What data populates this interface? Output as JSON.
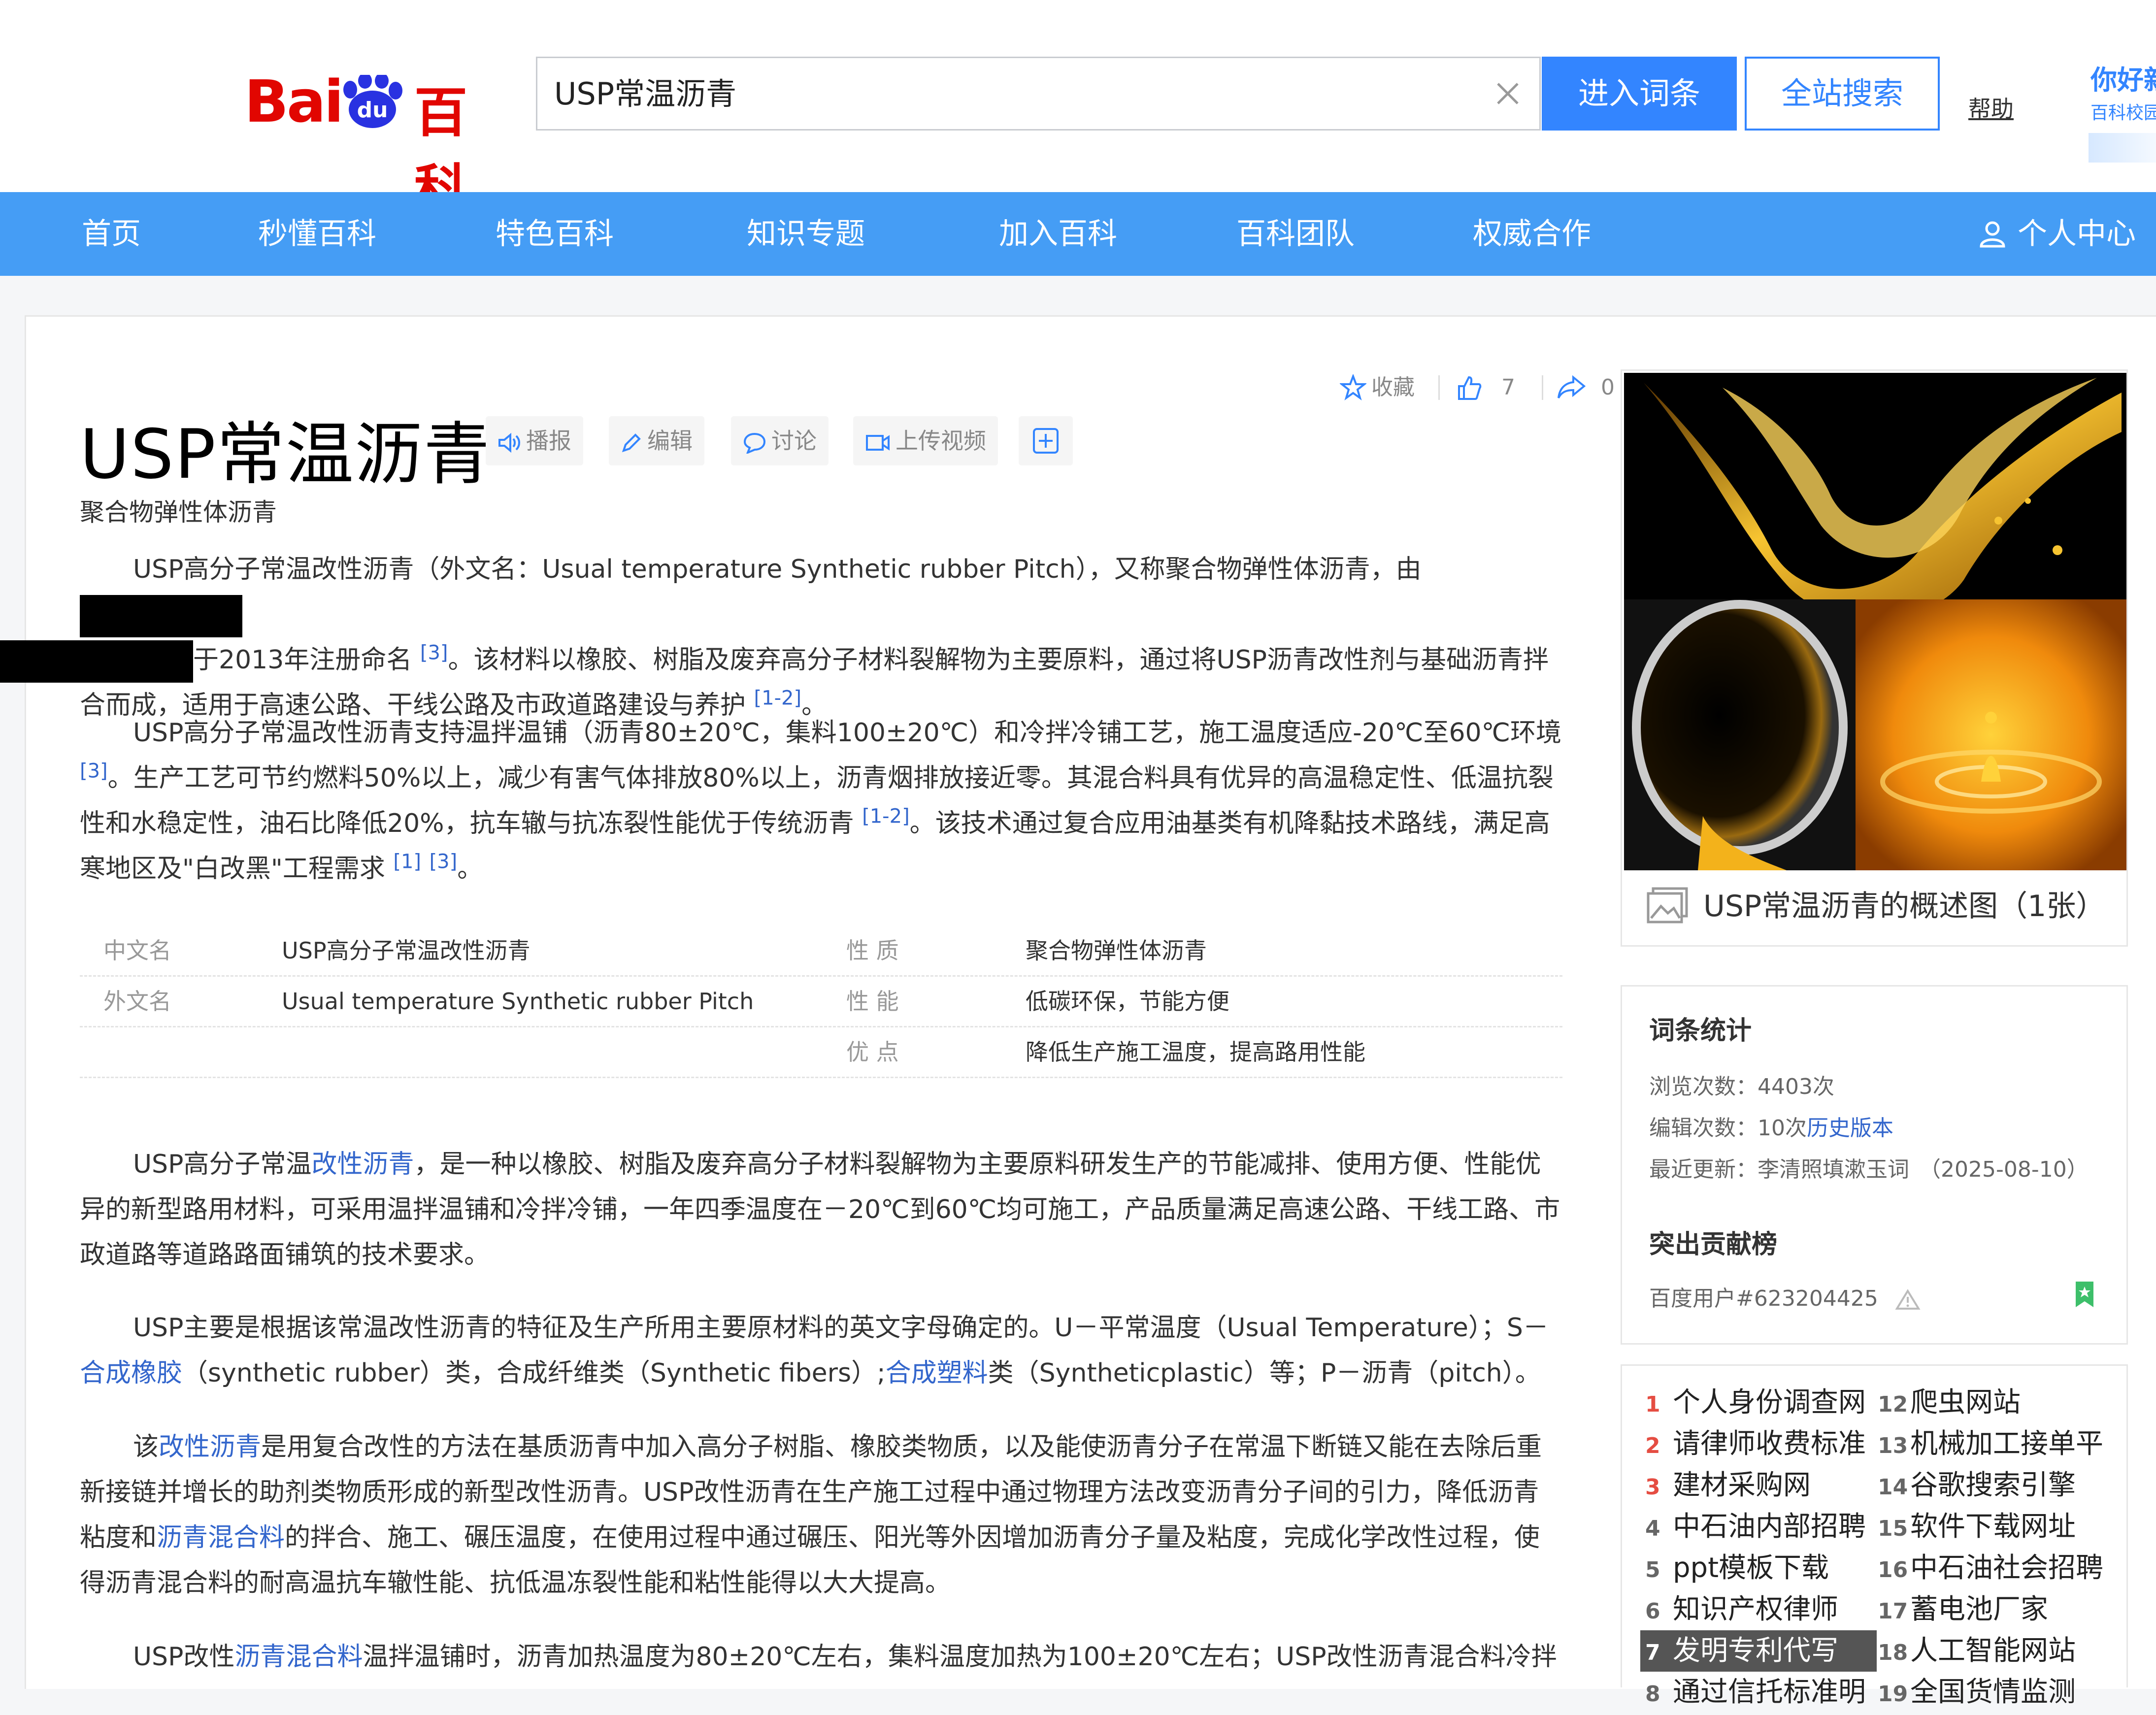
{
  "header": {
    "logo_bai": "Bai",
    "logo_du": "du",
    "logo_baike": "百科",
    "search_value": "USP常温沥青",
    "enter_button": "进入词条",
    "search_all_button": "全站搜索",
    "help_link": "帮助",
    "greeting": "你好新",
    "greeting_sub": "百科校园"
  },
  "nav": {
    "items": [
      "首页",
      "秒懂百科",
      "特色百科",
      "知识专题",
      "加入百科",
      "百科团队",
      "权威合作"
    ],
    "user_center": "个人中心"
  },
  "actions": {
    "favorite": "收藏",
    "likes": "7",
    "shares": "0"
  },
  "title": {
    "text": "USP常温沥青",
    "buttons": [
      "播报",
      "编辑",
      "讨论",
      "上传视频"
    ],
    "subtitle": "聚合物弹性体沥青"
  },
  "summary": {
    "p1": {
      "a": "USP高分子常温改性沥青（外文名：Usual temperature Synthetic rubber Pitch），又称聚合物弹性体沥青，由",
      "b": "于2013年注册命名",
      "ref1": "[3]",
      "c": "。该材料以橡胶、树脂及废弃高分子材料裂解物为主要原料，通过将USP沥青改性剂与基础沥青拌合而成，适用于高速公路、干线公路及市政道路建设与养护",
      "ref2": "[1-2]",
      "d": "。"
    },
    "p2": {
      "a": "USP高分子常温改性沥青支持温拌温铺（沥青80±20℃，集料100±20℃）和冷拌冷铺工艺，施工温度适应-20℃至60℃环境",
      "ref1": "[3]",
      "b": "。生产工艺可节约燃料50%以上，减少有害气体排放80%以上，沥青烟排放接近零。其混合料具有优异的高温稳定性、低温抗裂性和水稳定性，油石比降低20%，抗车辙与抗冻裂性能优于传统沥青",
      "ref2": "[1-2]",
      "c": "。该技术通过复合应用油基类有机降黏技术路线，满足高寒地区及\"白改黑\"工程需求",
      "ref3": "[1]",
      "ref4": "[3]",
      "d": "。"
    }
  },
  "basic_info": {
    "rows": [
      {
        "k1": "中文名",
        "v1": "USP高分子常温改性沥青",
        "k2": "性    质",
        "v2": "聚合物弹性体沥青"
      },
      {
        "k1": "外文名",
        "v1": "Usual temperature Synthetic rubber Pitch",
        "k2": "性    能",
        "v2": "低碳环保，节能方便"
      },
      {
        "k1": "",
        "v1": "",
        "k2": "优    点",
        "v2": "降低生产施工温度，提高路用性能"
      }
    ]
  },
  "body": {
    "p3": {
      "a": "USP高分子常温",
      "link1": "改性沥青",
      "b": "，是一种以橡胶、树脂及废弃高分子材料裂解物为主要原料研发生产的节能减排、使用方便、性能优异的新型路用材料，可采用温拌温铺和冷拌冷铺，一年四季温度在－20℃到60℃均可施工，产品质量满足高速公路、干线工路、市政道路等道路路面铺筑的技术要求。"
    },
    "p4": {
      "a": "USP主要是根据该常温改性沥青的特征及生产所用主要原材料的英文字母确定的。U－平常温度（Usual Temperature）；S－",
      "link1": "合成橡胶",
      "b": "（synthetic rubber）类，合成纤维类（Synthetic fibers）;",
      "link2": "合成塑料",
      "c": "类（Syntheticplastic）等；P－沥青（pitch）。"
    },
    "p5": {
      "a": "该",
      "link1": "改性沥青",
      "b": "是用复合改性的方法在基质沥青中加入高分子树脂、橡胶类物质，以及能使沥青分子在常温下断链又能在去除后重新接链并增长的助剂类物质形成的新型改性沥青。USP改性沥青在生产施工过程中通过物理方法改变沥青分子间的引力，降低沥青粘度和",
      "link2": "沥青混合料",
      "c": "的拌合、施工、碾压温度，在使用过程中通过碾压、阳光等外因增加沥青分子量及粘度，完成化学改性过程，使得沥青混合料的耐高温抗车辙性能、抗低温冻裂性能和粘性能得以大大提高。"
    },
    "p6": {
      "a": "USP改性",
      "link1": "沥青混合料",
      "b": "温拌温铺时，沥青加热温度为80±20℃左右，集料温度加热为100±20℃左右；USP改性沥青混合料冷拌"
    }
  },
  "album": {
    "caption": "USP常温沥青的概述图（1张）"
  },
  "stats": {
    "title": "词条统计",
    "views_label": "浏览次数：",
    "views_value": "4403次",
    "edits_label": "编辑次数：",
    "edits_value": "10次",
    "history_link": "历史版本",
    "updated_label": "最近更新：",
    "updated_user": "李清照填漱玉词",
    "updated_date": "（2025-08-10）",
    "contrib_title": "突出贡献榜",
    "contrib_user": "百度用户#623204425"
  },
  "hot_list": {
    "left": [
      {
        "n": "1",
        "t": "个人身份调查网"
      },
      {
        "n": "2",
        "t": "请律师收费标准"
      },
      {
        "n": "3",
        "t": "建材采购网"
      },
      {
        "n": "4",
        "t": "中石油内部招聘"
      },
      {
        "n": "5",
        "t": "ppt模板下载"
      },
      {
        "n": "6",
        "t": "知识产权律师"
      },
      {
        "n": "7",
        "t": "发明专利代写"
      },
      {
        "n": "8",
        "t": "通过信托标准明"
      }
    ],
    "right": [
      {
        "n": "12",
        "t": "爬虫网站"
      },
      {
        "n": "13",
        "t": "机械加工接单平"
      },
      {
        "n": "14",
        "t": "谷歌搜索引擎"
      },
      {
        "n": "15",
        "t": "软件下载网址"
      },
      {
        "n": "16",
        "t": "中石油社会招聘"
      },
      {
        "n": "17",
        "t": "蓄电池厂家"
      },
      {
        "n": "18",
        "t": "人工智能网站"
      },
      {
        "n": "19",
        "t": "全国货情监测"
      }
    ]
  }
}
